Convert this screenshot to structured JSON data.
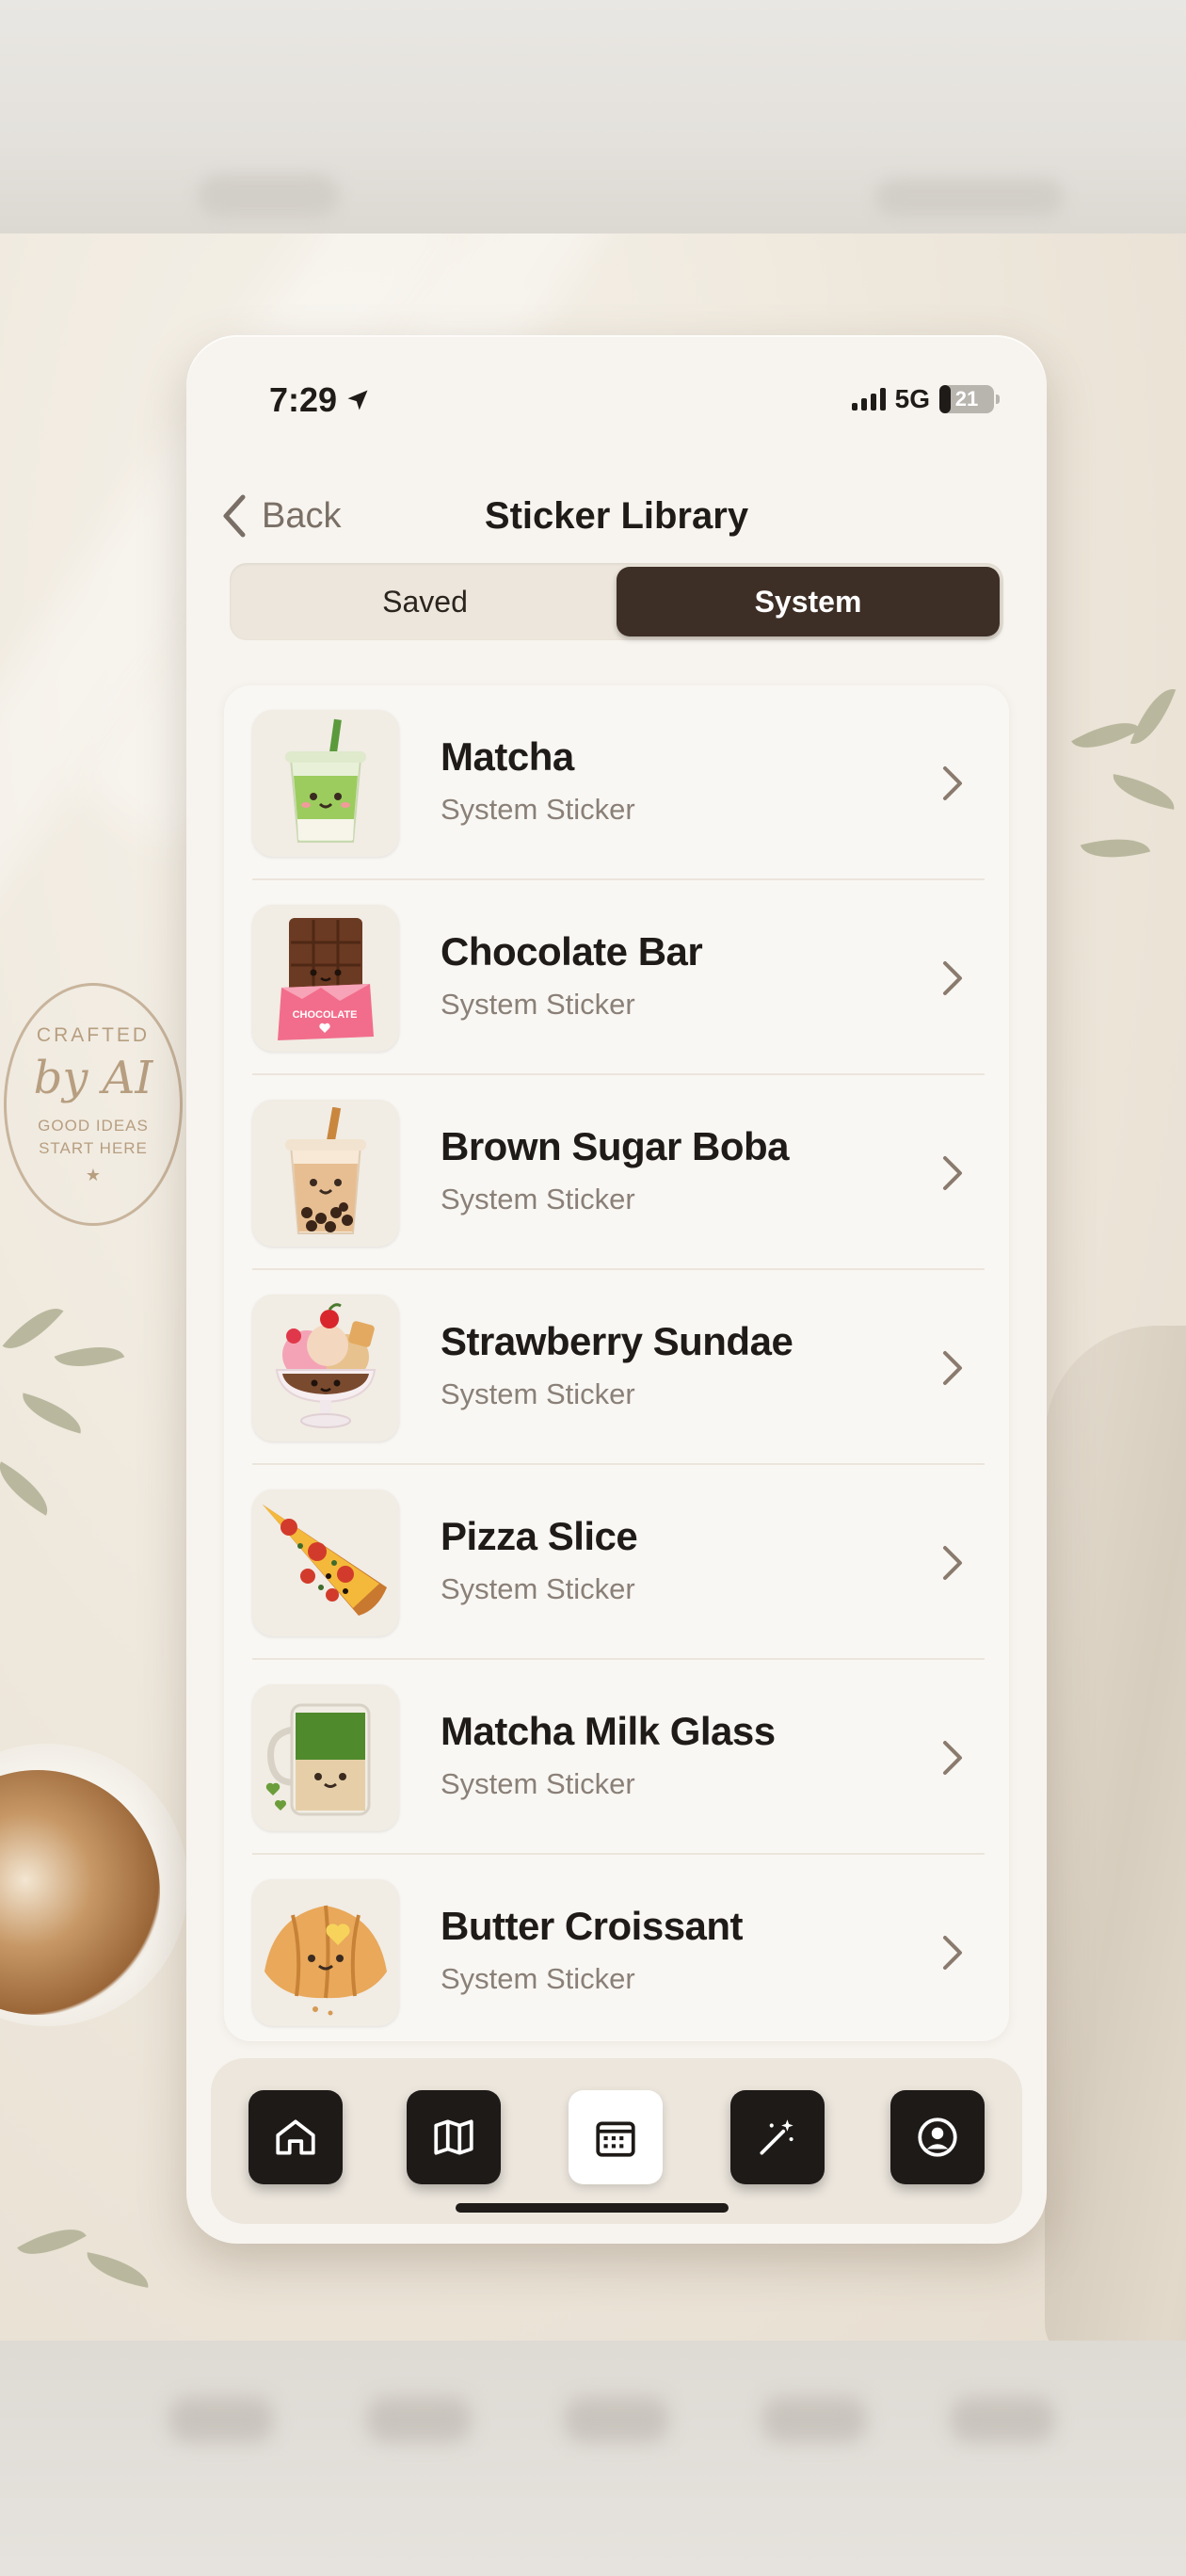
{
  "status_bar": {
    "time": "7:29",
    "network": "5G",
    "battery": "21",
    "battery_level": 0.21
  },
  "header": {
    "back_label": "Back",
    "title": "Sticker Library"
  },
  "tabs": {
    "saved_label": "Saved",
    "system_label": "System",
    "selected": "System"
  },
  "stickers": [
    {
      "name": "Matcha",
      "subtitle": "System Sticker",
      "icon": "matcha-drink-icon"
    },
    {
      "name": "Chocolate Bar",
      "subtitle": "System Sticker",
      "icon": "chocolate-bar-icon",
      "wrapper_text": "CHOCOLATE"
    },
    {
      "name": "Brown Sugar Boba",
      "subtitle": "System Sticker",
      "icon": "boba-tea-icon"
    },
    {
      "name": "Strawberry Sundae",
      "subtitle": "System Sticker",
      "icon": "sundae-icon"
    },
    {
      "name": "Pizza Slice",
      "subtitle": "System Sticker",
      "icon": "pizza-slice-icon"
    },
    {
      "name": "Matcha Milk Glass",
      "subtitle": "System Sticker",
      "icon": "matcha-milk-glass-icon"
    },
    {
      "name": "Butter Croissant",
      "subtitle": "System Sticker",
      "icon": "croissant-icon"
    }
  ],
  "bottom_nav": [
    {
      "name": "home",
      "icon": "home-icon"
    },
    {
      "name": "map",
      "icon": "map-icon"
    },
    {
      "name": "calendar",
      "icon": "calendar-icon",
      "selected": true
    },
    {
      "name": "magic",
      "icon": "magic-wand-icon"
    },
    {
      "name": "profile",
      "icon": "profile-icon"
    }
  ],
  "background": {
    "stamp": {
      "line1": "CRAFTED",
      "line2": "by AI",
      "line3": "GOOD IDEAS",
      "line4": "START HERE"
    }
  },
  "colors": {
    "accent_dark": "#3d2e26",
    "background": "#f7f4ef",
    "muted_text": "#8a8078"
  }
}
